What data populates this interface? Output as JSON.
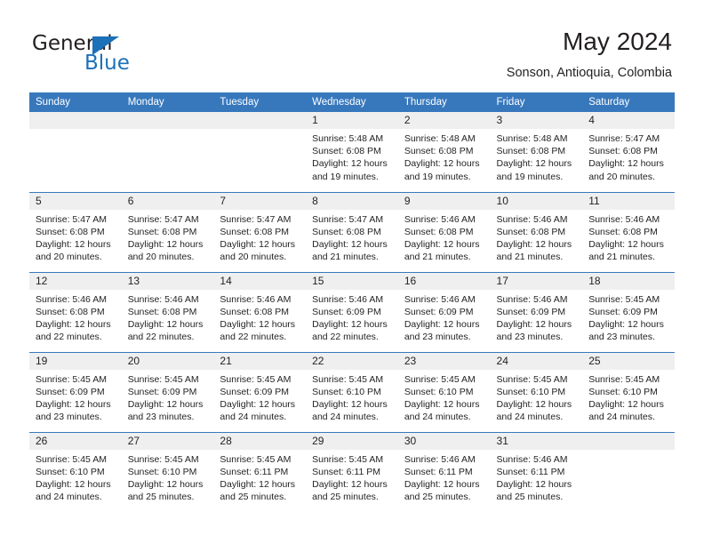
{
  "brand": {
    "name_dark": "General",
    "name_blue": "Blue",
    "accent_color": "#1c71b8"
  },
  "header": {
    "title": "May 2024",
    "location": "Sonson, Antioquia, Colombia"
  },
  "colors": {
    "header_band": "#3778bd",
    "daynum_band": "#efefef",
    "text": "#231f20"
  },
  "weekdays": [
    "Sunday",
    "Monday",
    "Tuesday",
    "Wednesday",
    "Thursday",
    "Friday",
    "Saturday"
  ],
  "weeks": [
    [
      {
        "day": "",
        "lines": []
      },
      {
        "day": "",
        "lines": []
      },
      {
        "day": "",
        "lines": []
      },
      {
        "day": "1",
        "lines": [
          "Sunrise: 5:48 AM",
          "Sunset: 6:08 PM",
          "Daylight: 12 hours",
          "and 19 minutes."
        ]
      },
      {
        "day": "2",
        "lines": [
          "Sunrise: 5:48 AM",
          "Sunset: 6:08 PM",
          "Daylight: 12 hours",
          "and 19 minutes."
        ]
      },
      {
        "day": "3",
        "lines": [
          "Sunrise: 5:48 AM",
          "Sunset: 6:08 PM",
          "Daylight: 12 hours",
          "and 19 minutes."
        ]
      },
      {
        "day": "4",
        "lines": [
          "Sunrise: 5:47 AM",
          "Sunset: 6:08 PM",
          "Daylight: 12 hours",
          "and 20 minutes."
        ]
      }
    ],
    [
      {
        "day": "5",
        "lines": [
          "Sunrise: 5:47 AM",
          "Sunset: 6:08 PM",
          "Daylight: 12 hours",
          "and 20 minutes."
        ]
      },
      {
        "day": "6",
        "lines": [
          "Sunrise: 5:47 AM",
          "Sunset: 6:08 PM",
          "Daylight: 12 hours",
          "and 20 minutes."
        ]
      },
      {
        "day": "7",
        "lines": [
          "Sunrise: 5:47 AM",
          "Sunset: 6:08 PM",
          "Daylight: 12 hours",
          "and 20 minutes."
        ]
      },
      {
        "day": "8",
        "lines": [
          "Sunrise: 5:47 AM",
          "Sunset: 6:08 PM",
          "Daylight: 12 hours",
          "and 21 minutes."
        ]
      },
      {
        "day": "9",
        "lines": [
          "Sunrise: 5:46 AM",
          "Sunset: 6:08 PM",
          "Daylight: 12 hours",
          "and 21 minutes."
        ]
      },
      {
        "day": "10",
        "lines": [
          "Sunrise: 5:46 AM",
          "Sunset: 6:08 PM",
          "Daylight: 12 hours",
          "and 21 minutes."
        ]
      },
      {
        "day": "11",
        "lines": [
          "Sunrise: 5:46 AM",
          "Sunset: 6:08 PM",
          "Daylight: 12 hours",
          "and 21 minutes."
        ]
      }
    ],
    [
      {
        "day": "12",
        "lines": [
          "Sunrise: 5:46 AM",
          "Sunset: 6:08 PM",
          "Daylight: 12 hours",
          "and 22 minutes."
        ]
      },
      {
        "day": "13",
        "lines": [
          "Sunrise: 5:46 AM",
          "Sunset: 6:08 PM",
          "Daylight: 12 hours",
          "and 22 minutes."
        ]
      },
      {
        "day": "14",
        "lines": [
          "Sunrise: 5:46 AM",
          "Sunset: 6:08 PM",
          "Daylight: 12 hours",
          "and 22 minutes."
        ]
      },
      {
        "day": "15",
        "lines": [
          "Sunrise: 5:46 AM",
          "Sunset: 6:09 PM",
          "Daylight: 12 hours",
          "and 22 minutes."
        ]
      },
      {
        "day": "16",
        "lines": [
          "Sunrise: 5:46 AM",
          "Sunset: 6:09 PM",
          "Daylight: 12 hours",
          "and 23 minutes."
        ]
      },
      {
        "day": "17",
        "lines": [
          "Sunrise: 5:46 AM",
          "Sunset: 6:09 PM",
          "Daylight: 12 hours",
          "and 23 minutes."
        ]
      },
      {
        "day": "18",
        "lines": [
          "Sunrise: 5:45 AM",
          "Sunset: 6:09 PM",
          "Daylight: 12 hours",
          "and 23 minutes."
        ]
      }
    ],
    [
      {
        "day": "19",
        "lines": [
          "Sunrise: 5:45 AM",
          "Sunset: 6:09 PM",
          "Daylight: 12 hours",
          "and 23 minutes."
        ]
      },
      {
        "day": "20",
        "lines": [
          "Sunrise: 5:45 AM",
          "Sunset: 6:09 PM",
          "Daylight: 12 hours",
          "and 23 minutes."
        ]
      },
      {
        "day": "21",
        "lines": [
          "Sunrise: 5:45 AM",
          "Sunset: 6:09 PM",
          "Daylight: 12 hours",
          "and 24 minutes."
        ]
      },
      {
        "day": "22",
        "lines": [
          "Sunrise: 5:45 AM",
          "Sunset: 6:10 PM",
          "Daylight: 12 hours",
          "and 24 minutes."
        ]
      },
      {
        "day": "23",
        "lines": [
          "Sunrise: 5:45 AM",
          "Sunset: 6:10 PM",
          "Daylight: 12 hours",
          "and 24 minutes."
        ]
      },
      {
        "day": "24",
        "lines": [
          "Sunrise: 5:45 AM",
          "Sunset: 6:10 PM",
          "Daylight: 12 hours",
          "and 24 minutes."
        ]
      },
      {
        "day": "25",
        "lines": [
          "Sunrise: 5:45 AM",
          "Sunset: 6:10 PM",
          "Daylight: 12 hours",
          "and 24 minutes."
        ]
      }
    ],
    [
      {
        "day": "26",
        "lines": [
          "Sunrise: 5:45 AM",
          "Sunset: 6:10 PM",
          "Daylight: 12 hours",
          "and 24 minutes."
        ]
      },
      {
        "day": "27",
        "lines": [
          "Sunrise: 5:45 AM",
          "Sunset: 6:10 PM",
          "Daylight: 12 hours",
          "and 25 minutes."
        ]
      },
      {
        "day": "28",
        "lines": [
          "Sunrise: 5:45 AM",
          "Sunset: 6:11 PM",
          "Daylight: 12 hours",
          "and 25 minutes."
        ]
      },
      {
        "day": "29",
        "lines": [
          "Sunrise: 5:45 AM",
          "Sunset: 6:11 PM",
          "Daylight: 12 hours",
          "and 25 minutes."
        ]
      },
      {
        "day": "30",
        "lines": [
          "Sunrise: 5:46 AM",
          "Sunset: 6:11 PM",
          "Daylight: 12 hours",
          "and 25 minutes."
        ]
      },
      {
        "day": "31",
        "lines": [
          "Sunrise: 5:46 AM",
          "Sunset: 6:11 PM",
          "Daylight: 12 hours",
          "and 25 minutes."
        ]
      },
      {
        "day": "",
        "lines": []
      }
    ]
  ]
}
